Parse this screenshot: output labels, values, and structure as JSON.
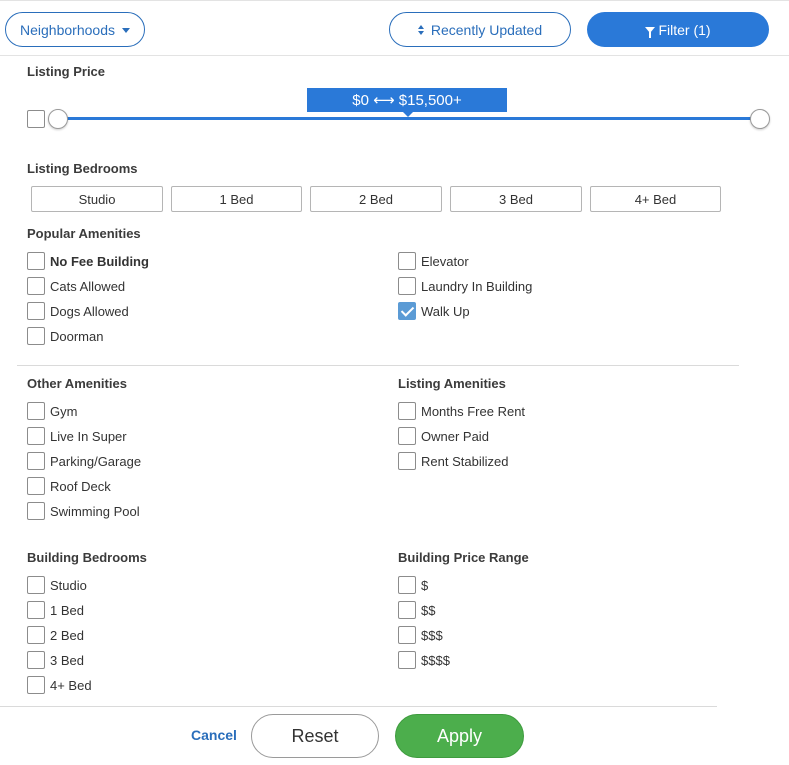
{
  "toolbar": {
    "neighborhoods_label": "Neighborhoods",
    "sort_label": "Recently Updated",
    "filter_label": "Filter (1)"
  },
  "listing_price": {
    "label": "Listing Price",
    "range_text": "$0 ⟷ $15,500+",
    "min": 0,
    "max": 15500,
    "lower_value": 0,
    "upper_value": 15500
  },
  "listing_bedrooms": {
    "label": "Listing Bedrooms",
    "options": [
      "Studio",
      "1 Bed",
      "2 Bed",
      "3 Bed",
      "4+ Bed"
    ]
  },
  "popular_amenities": {
    "label": "Popular Amenities",
    "left": [
      {
        "text": "No Fee Building",
        "checked": false
      },
      {
        "text": "Cats Allowed",
        "checked": false
      },
      {
        "text": "Dogs Allowed",
        "checked": false
      },
      {
        "text": "Doorman",
        "checked": false
      }
    ],
    "right": [
      {
        "text": "Elevator",
        "checked": false
      },
      {
        "text": "Laundry In Building",
        "checked": false
      },
      {
        "text": "Walk Up",
        "checked": true
      }
    ]
  },
  "other_amenities": {
    "label": "Other Amenities",
    "items": [
      {
        "text": "Gym",
        "checked": false
      },
      {
        "text": "Live In Super",
        "checked": false
      },
      {
        "text": "Parking/Garage",
        "checked": false
      },
      {
        "text": "Roof Deck",
        "checked": false
      },
      {
        "text": "Swimming Pool",
        "checked": false
      }
    ]
  },
  "listing_amenities": {
    "label": "Listing Amenities",
    "items": [
      {
        "text": "Months Free Rent",
        "checked": false
      },
      {
        "text": "Owner Paid",
        "checked": false
      },
      {
        "text": "Rent Stabilized",
        "checked": false
      }
    ]
  },
  "building_bedrooms": {
    "label": "Building Bedrooms",
    "items": [
      {
        "text": "Studio",
        "checked": false
      },
      {
        "text": "1 Bed",
        "checked": false
      },
      {
        "text": "2 Bed",
        "checked": false
      },
      {
        "text": "3 Bed",
        "checked": false
      },
      {
        "text": "4+ Bed",
        "checked": false
      }
    ]
  },
  "building_price_range": {
    "label": "Building Price Range",
    "items": [
      {
        "text": "$",
        "checked": false
      },
      {
        "text": "$$",
        "checked": false
      },
      {
        "text": "$$$",
        "checked": false
      },
      {
        "text": "$$$$",
        "checked": false
      }
    ]
  },
  "footer": {
    "cancel_label": "Cancel",
    "reset_label": "Reset",
    "apply_label": "Apply"
  },
  "colors": {
    "accent": "#2a79d8",
    "apply": "#4cae4c",
    "checked": "#5b9bd5"
  }
}
